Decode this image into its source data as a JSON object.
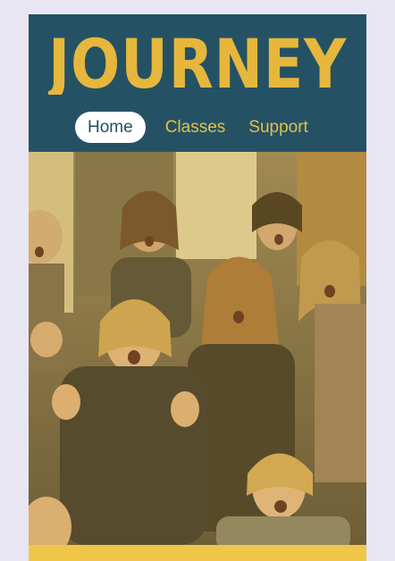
{
  "brand": {
    "logo_text": "JOURNEY",
    "logo_color": "#e6b73c",
    "header_bg": "#245264"
  },
  "nav": {
    "items": [
      {
        "label": "Home",
        "active": true
      },
      {
        "label": "Classes",
        "active": false
      },
      {
        "label": "Support",
        "active": false
      }
    ],
    "text_color": "#e8bf44"
  },
  "hero": {
    "image": "group-of-women-singing-expressively-photo",
    "tint": "#f2c54a"
  },
  "footer_strip": {
    "color": "#f0c648"
  }
}
